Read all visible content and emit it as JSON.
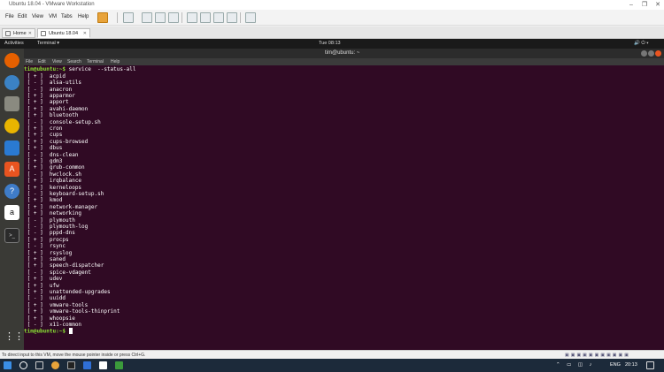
{
  "window": {
    "title": "Ubuntu 18.04 - VMware Workstation",
    "controls": [
      "–",
      "❐",
      "✕"
    ]
  },
  "vm_menu": {
    "items": [
      "File",
      "Edit",
      "View",
      "VM",
      "Tabs",
      "Help"
    ]
  },
  "vm_tabs": [
    {
      "label": "Home",
      "icon": "home-icon"
    },
    {
      "label": "Ubuntu 18.04",
      "icon": "vm-icon"
    }
  ],
  "gnome": {
    "activities": "Activities",
    "app_menu": "Terminal ▾",
    "clock": "Tue 08:13",
    "tray": "🔊 ⏻ ▾"
  },
  "terminal": {
    "title": "tim@ubuntu: ~",
    "menu": [
      "File",
      "Edit",
      "View",
      "Search",
      "Terminal",
      "Help"
    ],
    "prompt": "tim@ubuntu:~$",
    "command": " service  --status-all",
    "services": [
      {
        "status": "+",
        "name": "acpid"
      },
      {
        "status": "-",
        "name": "alsa-utils"
      },
      {
        "status": "-",
        "name": "anacron"
      },
      {
        "status": "+",
        "name": "apparmor"
      },
      {
        "status": "+",
        "name": "apport"
      },
      {
        "status": "+",
        "name": "avahi-daemon"
      },
      {
        "status": "+",
        "name": "bluetooth"
      },
      {
        "status": "-",
        "name": "console-setup.sh"
      },
      {
        "status": "+",
        "name": "cron"
      },
      {
        "status": "+",
        "name": "cups"
      },
      {
        "status": "+",
        "name": "cups-browsed"
      },
      {
        "status": "+",
        "name": "dbus"
      },
      {
        "status": "-",
        "name": "dns-clean"
      },
      {
        "status": "+",
        "name": "gdm3"
      },
      {
        "status": "+",
        "name": "grub-common"
      },
      {
        "status": "-",
        "name": "hwclock.sh"
      },
      {
        "status": "+",
        "name": "irqbalance"
      },
      {
        "status": "+",
        "name": "kerneloops"
      },
      {
        "status": "-",
        "name": "keyboard-setup.sh"
      },
      {
        "status": "+",
        "name": "kmod"
      },
      {
        "status": "+",
        "name": "network-manager"
      },
      {
        "status": "+",
        "name": "networking"
      },
      {
        "status": "-",
        "name": "plymouth"
      },
      {
        "status": "-",
        "name": "plymouth-log"
      },
      {
        "status": "-",
        "name": "pppd-dns"
      },
      {
        "status": "+",
        "name": "procps"
      },
      {
        "status": "-",
        "name": "rsync"
      },
      {
        "status": "+",
        "name": "rsyslog"
      },
      {
        "status": "+",
        "name": "saned"
      },
      {
        "status": "+",
        "name": "speech-dispatcher"
      },
      {
        "status": "-",
        "name": "spice-vdagent"
      },
      {
        "status": "+",
        "name": "udev"
      },
      {
        "status": "+",
        "name": "ufw"
      },
      {
        "status": "+",
        "name": "unattended-upgrades"
      },
      {
        "status": "-",
        "name": "uuidd"
      },
      {
        "status": "+",
        "name": "vmware-tools"
      },
      {
        "status": "+",
        "name": "vmware-tools-thinprint"
      },
      {
        "status": "+",
        "name": "whoopsie"
      },
      {
        "status": "-",
        "name": "x11-common"
      }
    ]
  },
  "status_bar": {
    "text": "To direct input to this VM, move the mouse pointer inside or press Ctrl+G."
  },
  "taskbar": {
    "lang": "ENG",
    "time": "20:13"
  },
  "colors": {
    "terminal_bg": "#300a24",
    "prompt": "#8ae234",
    "ubuntu_orange": "#e95420"
  }
}
